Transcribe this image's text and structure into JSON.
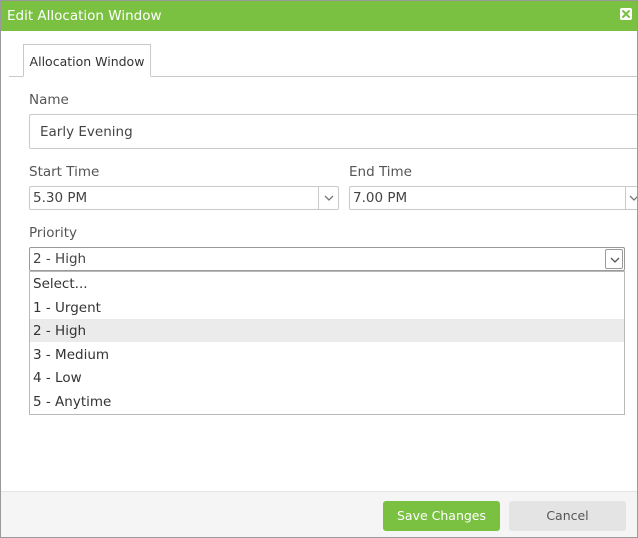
{
  "dialog": {
    "title": "Edit Allocation Window",
    "close_icon": "close-icon",
    "accent_color": "#7ac142"
  },
  "tabs": [
    {
      "label": "Allocation Window",
      "active": true
    }
  ],
  "form": {
    "name": {
      "label": "Name",
      "value": "Early Evening"
    },
    "start_time": {
      "label": "Start Time",
      "value": "5.30 PM"
    },
    "end_time": {
      "label": "End Time",
      "value": "7.00 PM"
    },
    "priority": {
      "label": "Priority",
      "value": "2 - High",
      "options": [
        "Select...",
        "1 - Urgent",
        "2 - High",
        "3 - Medium",
        "4 - Low",
        "5 - Anytime"
      ],
      "selected_index": 2,
      "expanded": true
    }
  },
  "footer": {
    "save_label": "Save Changes",
    "cancel_label": "Cancel"
  }
}
